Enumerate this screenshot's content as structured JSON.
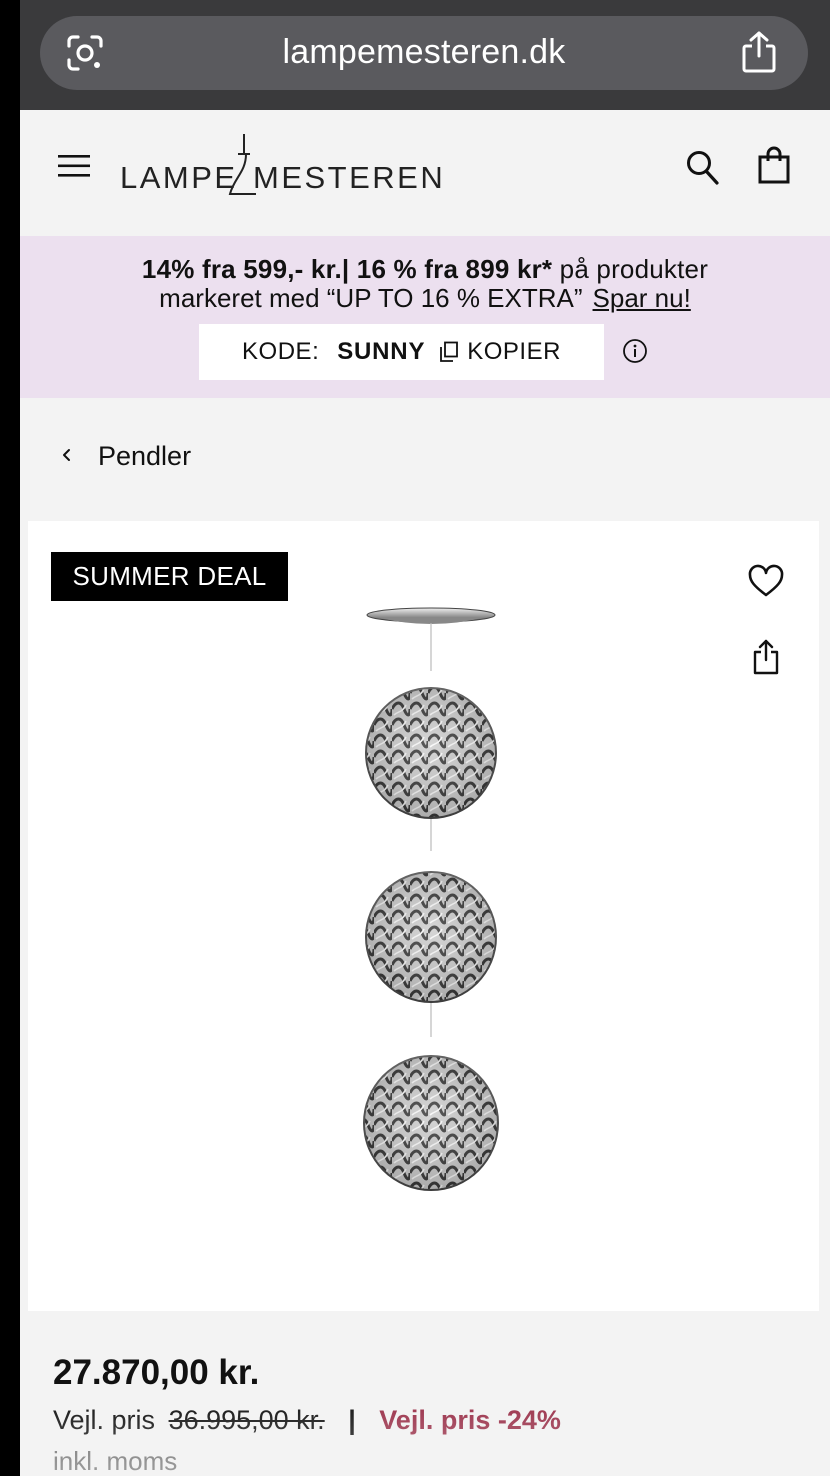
{
  "browser": {
    "url": "lampemesteren.dk"
  },
  "header": {
    "logo_left": "LAMPE",
    "logo_right": "MESTEREN",
    "icons": [
      "menu-icon",
      "search-icon",
      "bag-icon"
    ]
  },
  "promo": {
    "bold_text": "14% fra 599,- kr.| 16 % fra 899 kr*",
    "text_after_bold": " på produkter",
    "line2": "markeret med “UP TO 16 % EXTRA”",
    "link": "Spar nu!",
    "code_label": "KODE:",
    "code_value": "SUNNY",
    "copy_label": "KOPIER",
    "background": "#ece0ef"
  },
  "breadcrumb": {
    "label": "Pendler"
  },
  "product": {
    "badge": "SUMMER DEAL",
    "price": "27.870,00 kr.",
    "rrp_label": "Vejl. pris",
    "rrp_value": "36.995,00 kr.",
    "separator": "|",
    "discount": "Vejl. pris -24%",
    "vat_note": "inkl. moms",
    "discount_color": "#9a3049"
  }
}
